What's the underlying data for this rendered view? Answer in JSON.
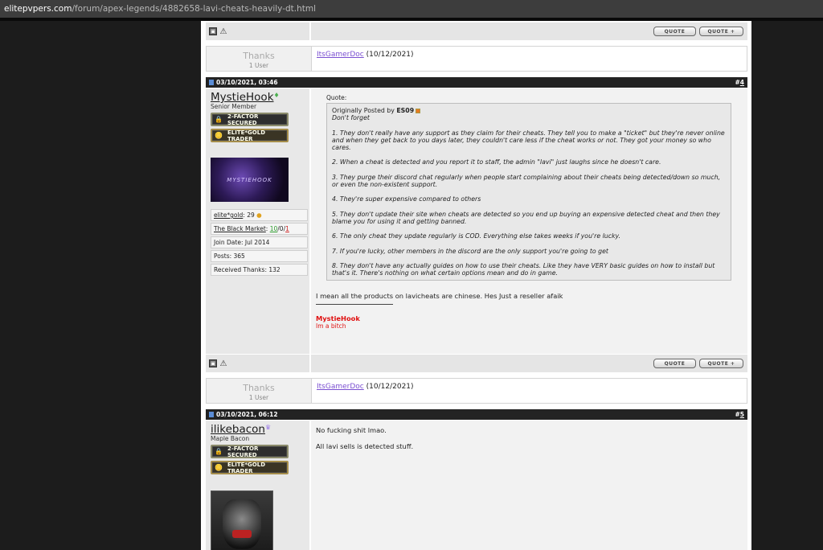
{
  "url": {
    "domain": "elitepvpers.com",
    "path": "/forum/apex-legends/4882658-lavi-cheats-heavily-dt.html"
  },
  "actions": {
    "quote_label": "QUOTE",
    "multiquote_label": "QUOTE +"
  },
  "thanks_block": {
    "label": "Thanks",
    "count": "1 User"
  },
  "thanks_1": {
    "user": "ItsGamerDoc",
    "date": "(10/12/2021)"
  },
  "post4": {
    "date": "03/10/2021, 03:46",
    "number": "4",
    "username": "MystieHook",
    "user_title": "Senior Member",
    "badge_2fa": "2-FACTOR SECURED",
    "badge_gold": "ELITE*GOLD TRADER",
    "banner_text": "MYSTIEHOOK",
    "stats": {
      "elite_gold_label": "elite*gold",
      "elite_gold_value": ": 29",
      "market_label": "The Black Market",
      "market_sep": ":",
      "market_pos": "10",
      "market_neu": "0",
      "market_neg": "1",
      "join_date": "Join Date: Jul 2014",
      "posts": "Posts: 365",
      "received_thanks": "Received Thanks: 132"
    },
    "quote_label": "Quote:",
    "quote_prefix": "Originally Posted by",
    "quote_author": "ES09",
    "quote_lines": [
      "Don't forget",
      "1. They don't really have any support as they claim for their cheats. They tell you to make a \"ticket\" but they're never online and when they get back to you days later, they couldn't care less if the cheat works or not. They got your money so who cares.",
      "2. When a cheat is detected and you report it to staff, the admin \"lavi\" just laughs since he doesn't care.",
      "3. They purge their discord chat regularly when people start complaining about their cheats being detected/down so much, or even the non-existent support.",
      "4. They're super expensive compared to others",
      "5. They don't update their site when cheats are detected so you end up buying an expensive detected cheat and then they blame you for using it and getting banned.",
      "6. The only cheat they update regularly is COD. Everything else takes weeks if you're lucky.",
      "7. If you're lucky, other members in the discord are the only support you're going to get",
      "8. They don't have any actually guides on how to use their cheats. Like they have VERY basic guides on how to install but that's it. There's nothing on what certain options mean and do in game."
    ],
    "message": "I mean all the products on lavicheats are chinese. Hes Just a reseller afaik",
    "signature_name": "MystieHook",
    "signature_sub": "Im a bitch"
  },
  "thanks_2": {
    "user": "ItsGamerDoc",
    "date": "(10/12/2021)"
  },
  "post5": {
    "date": "03/10/2021, 06:12",
    "number": "5",
    "username": "ilikebacon",
    "user_title": "Maple Bacon",
    "badge_2fa": "2-FACTOR SECURED",
    "badge_gold": "ELITE*GOLD TRADER",
    "line1": "No fucking shit lmao.",
    "line2": "All lavi sells is detected stuff."
  },
  "colors": {
    "header_bg": "#232323",
    "link": "#7a4fd1",
    "signature": "#e01010",
    "panel": "#e8e8e8"
  }
}
